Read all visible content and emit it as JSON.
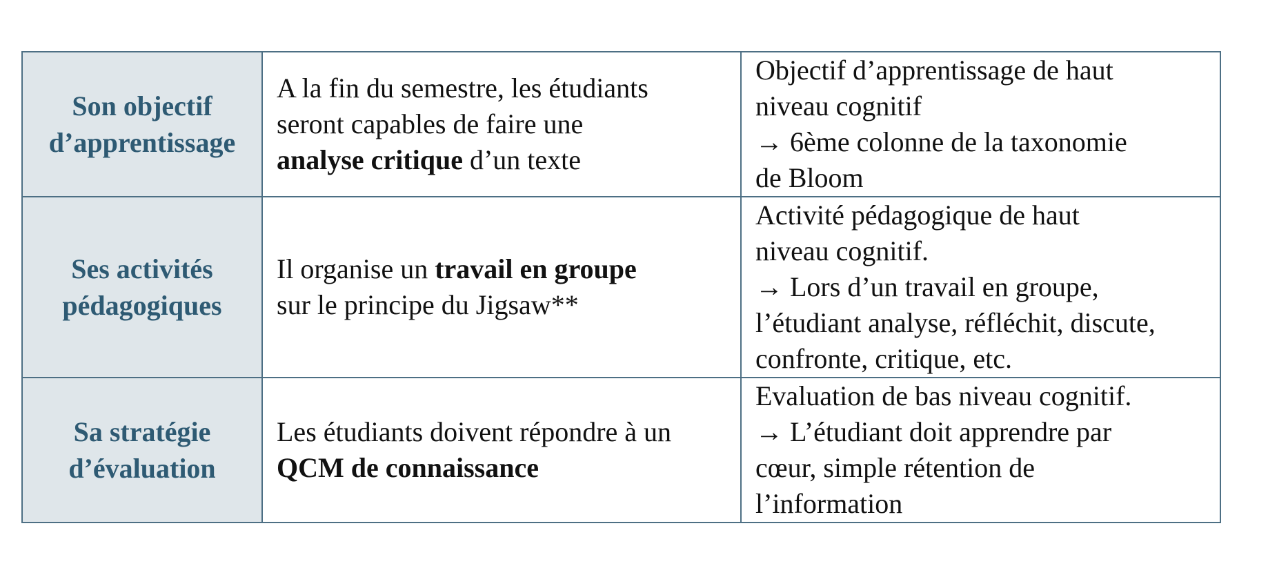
{
  "rows": [
    {
      "header": [
        "Son objectif",
        "d’apprentissage"
      ],
      "description": {
        "lines": [
          {
            "before": "A la fin du semestre, les étudiants",
            "bold": "",
            "after": ""
          },
          {
            "before": "seront capables de faire une",
            "bold": "",
            "after": ""
          },
          {
            "before": "",
            "bold": "analyse critique",
            "after": " d’un texte"
          }
        ]
      },
      "analysis": [
        "Objectif d’apprentissage de haut",
        "niveau cognitif",
        "→ 6ème colonne de la taxonomie",
        "de Bloom"
      ]
    },
    {
      "header": [
        "Ses activités",
        "pédagogiques"
      ],
      "description": {
        "lines": [
          {
            "before": "Il organise un ",
            "bold": "travail en groupe",
            "after": ""
          },
          {
            "before": "sur le principe du Jigsaw**",
            "bold": "",
            "after": ""
          }
        ]
      },
      "analysis": [
        "Activité pédagogique de haut",
        "niveau cognitif.",
        "→ Lors d’un travail en groupe,",
        "l’étudiant analyse, réfléchit, discute,",
        "confronte, critique, etc."
      ]
    },
    {
      "header": [
        "Sa stratégie",
        "d’évaluation"
      ],
      "description": {
        "lines": [
          {
            "before": "Les étudiants doivent répondre à un",
            "bold": "",
            "after": ""
          },
          {
            "before": "",
            "bold": "QCM de connaissance",
            "after": ""
          }
        ]
      },
      "analysis": [
        "Evaluation de bas niveau cognitif.",
        "→ L’étudiant doit apprendre par",
        "cœur, simple rétention de",
        "l’information"
      ]
    }
  ],
  "colors": {
    "header_background": "#dfe6ea",
    "header_text": "#2e5a73",
    "border": "#4d6f84"
  }
}
